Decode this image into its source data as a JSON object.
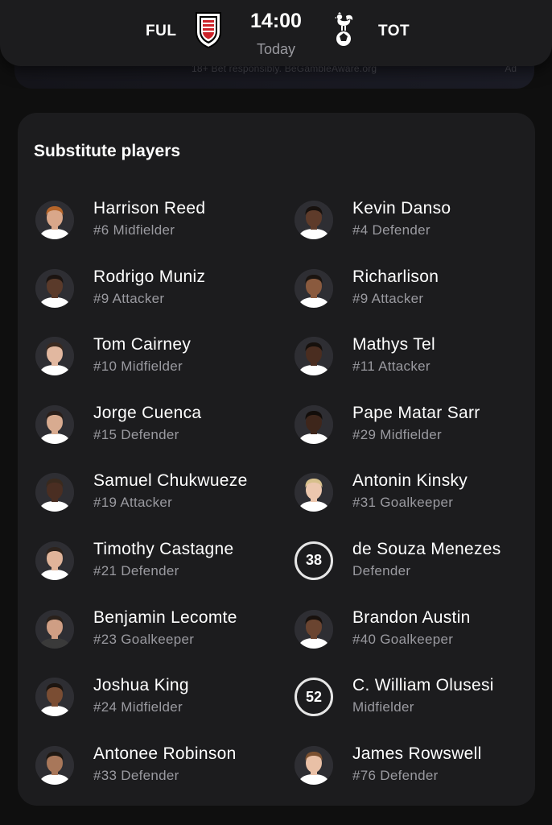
{
  "ad": {
    "disclaimer": "18+ Bet responsibly. BeGambleAware.org",
    "label": "Ad"
  },
  "match": {
    "home_code": "FUL",
    "away_code": "TOT",
    "kickoff_time": "14:00",
    "kickoff_day": "Today",
    "home_crest_icon": "fulham-crest-icon",
    "away_crest_icon": "tottenham-cockerel-icon"
  },
  "substitutes": {
    "title": "Substitute players",
    "home": [
      {
        "name": "Harrison Reed",
        "meta": "#6 Midfielder",
        "photo": true,
        "skin": "#d9a78a",
        "hair": "#b5652a",
        "shirt": "#ffffff"
      },
      {
        "name": "Rodrigo Muniz",
        "meta": "#9 Attacker",
        "photo": true,
        "skin": "#5a3a2a",
        "hair": "#1b1411",
        "shirt": "#ffffff"
      },
      {
        "name": "Tom Cairney",
        "meta": "#10 Midfielder",
        "photo": true,
        "skin": "#e2b8a0",
        "hair": "#3b2a20",
        "shirt": "#ffffff"
      },
      {
        "name": "Jorge Cuenca",
        "meta": "#15 Defender",
        "photo": true,
        "skin": "#d8ab90",
        "hair": "#2a1f1a",
        "shirt": "#ffffff"
      },
      {
        "name": "Samuel Chukwueze",
        "meta": "#19 Attacker",
        "photo": true,
        "skin": "#4a2e22",
        "hair": "#3a2a1e",
        "shirt": "#ffffff"
      },
      {
        "name": "Timothy Castagne",
        "meta": "#21 Defender",
        "photo": true,
        "skin": "#e0b49a",
        "hair": "#2d231d",
        "shirt": "#ffffff"
      },
      {
        "name": "Benjamin Lecomte",
        "meta": "#23 Goalkeeper",
        "photo": true,
        "skin": "#cf9e84",
        "hair": "#2a211b",
        "shirt": "#3a3a3a"
      },
      {
        "name": "Joshua King",
        "meta": "#24 Midfielder",
        "photo": true,
        "skin": "#7a4d33",
        "hair": "#1d1510",
        "shirt": "#ffffff"
      },
      {
        "name": "Antonee Robinson",
        "meta": "#33 Defender",
        "photo": true,
        "skin": "#a8775a",
        "hair": "#1f1812",
        "shirt": "#ffffff"
      }
    ],
    "away": [
      {
        "name": "Kevin Danso",
        "meta": "#4 Defender",
        "photo": true,
        "skin": "#5e3b2a",
        "hair": "#17110e",
        "shirt": "#ffffff"
      },
      {
        "name": "Richarlison",
        "meta": "#9 Attacker",
        "photo": true,
        "skin": "#8a5a3e",
        "hair": "#1a1410",
        "shirt": "#ffffff"
      },
      {
        "name": "Mathys Tel",
        "meta": "#11 Attacker",
        "photo": true,
        "skin": "#4a2d20",
        "hair": "#16100c",
        "shirt": "#ffffff"
      },
      {
        "name": "Pape Matar Sarr",
        "meta": "#29 Midfielder",
        "photo": true,
        "skin": "#3e261b",
        "hair": "#120d0a",
        "shirt": "#ffffff"
      },
      {
        "name": "Antonin Kinsky",
        "meta": "#31 Goalkeeper",
        "photo": true,
        "skin": "#ecc7ae",
        "hair": "#d7c08c",
        "shirt": "#ffffff"
      },
      {
        "name": "de Souza Menezes",
        "meta": "Defender",
        "photo": false,
        "number": "38"
      },
      {
        "name": "Brandon Austin",
        "meta": "#40 Goalkeeper",
        "photo": true,
        "skin": "#6a4430",
        "hair": "#18110d",
        "shirt": "#ffffff"
      },
      {
        "name": "C. William Olusesi",
        "meta": "Midfielder",
        "photo": false,
        "number": "52"
      },
      {
        "name": "James Rowswell",
        "meta": "#76 Defender",
        "photo": true,
        "skin": "#e9c0a6",
        "hair": "#7a5030",
        "shirt": "#ffffff"
      }
    ]
  }
}
